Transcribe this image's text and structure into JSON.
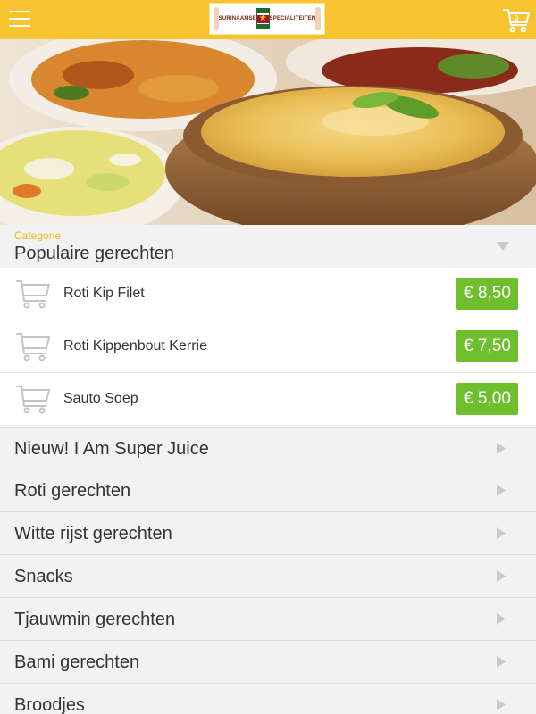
{
  "header": {
    "logo": {
      "left_text": "SURINAAMSE",
      "right_text": "SPECIALITEITEN"
    },
    "cart_count": "0"
  },
  "category": {
    "label": "Categorie",
    "selected": "Populaire gerechten"
  },
  "products": [
    {
      "name": "Roti Kip Filet",
      "price": "€ 8,50"
    },
    {
      "name": "Roti Kippenbout Kerrie",
      "price": "€ 7,50"
    },
    {
      "name": "Sauto Soep",
      "price": "€ 5,00"
    }
  ],
  "categories": [
    {
      "label": "Nieuw! I Am Super Juice"
    },
    {
      "label": "Roti gerechten"
    },
    {
      "label": "Witte rijst gerechten"
    },
    {
      "label": "Snacks"
    },
    {
      "label": "Tjauwmin gerechten"
    },
    {
      "label": "Bami gerechten"
    },
    {
      "label": "Broodjes"
    }
  ],
  "colors": {
    "header": "#f7c32e",
    "price_badge": "#6fbe2e",
    "category_label": "#f1b51c"
  },
  "icons": {
    "menu": "hamburger-icon",
    "cart": "shopping-cart-icon",
    "dropdown": "triangle-down-icon",
    "row": "triangle-right-icon"
  }
}
